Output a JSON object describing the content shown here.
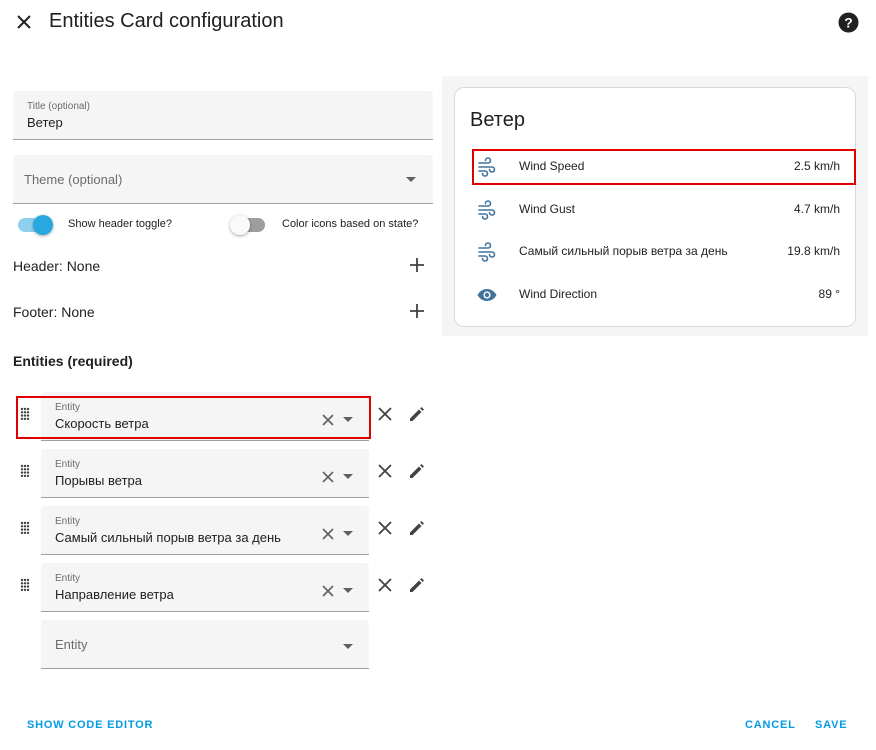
{
  "dialog": {
    "title": "Entities Card configuration"
  },
  "form": {
    "title_field": {
      "label": "Title (optional)",
      "value": "Ветер"
    },
    "theme_field": {
      "placeholder": "Theme (optional)"
    },
    "show_header_toggle": {
      "label": "Show header toggle?",
      "on": true
    },
    "color_icons_toggle": {
      "label": "Color icons based on state?",
      "on": false
    },
    "header": {
      "label": "Header: None"
    },
    "footer": {
      "label": "Footer: None"
    },
    "entities_title": "Entities (required)",
    "entities": [
      {
        "label": "Entity",
        "value": "Скорость ветра"
      },
      {
        "label": "Entity",
        "value": "Порывы ветра"
      },
      {
        "label": "Entity",
        "value": "Самый сильный порыв ветра за день"
      },
      {
        "label": "Entity",
        "value": "Направление ветра"
      }
    ],
    "new_entity": {
      "placeholder": "Entity"
    }
  },
  "preview": {
    "card_title": "Ветер",
    "rows": [
      {
        "icon": "weather-windy-icon",
        "name": "Wind Speed",
        "value": "2.5 km/h"
      },
      {
        "icon": "weather-windy-icon",
        "name": "Wind Gust",
        "value": "4.7 km/h"
      },
      {
        "icon": "weather-windy-icon",
        "name": "Самый сильный порыв ветра за день",
        "value": "19.8 km/h"
      },
      {
        "icon": "eye-icon",
        "name": "Wind Direction",
        "value": "89 °"
      }
    ]
  },
  "footer_actions": {
    "show_code_editor": "SHOW CODE EDITOR",
    "cancel": "CANCEL",
    "save": "SAVE"
  },
  "colors": {
    "accent": "#039be5",
    "toggle_on": "#29a8e0",
    "icon": "#44739e",
    "highlight": "#e00000"
  }
}
